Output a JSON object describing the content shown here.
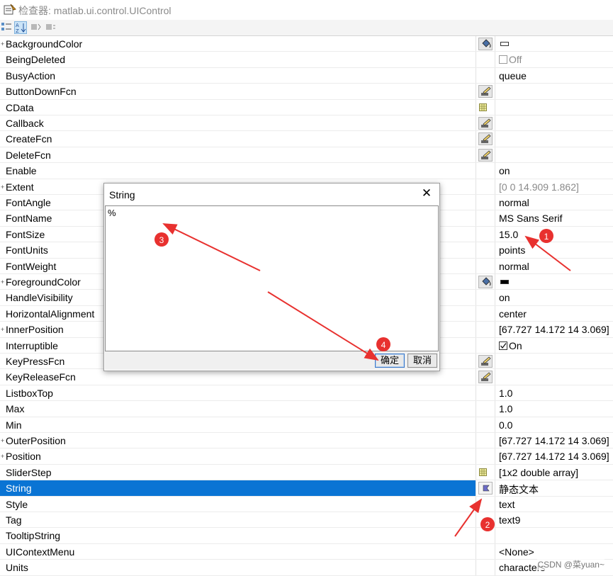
{
  "window": {
    "title": "检查器: matlab.ui.control.UIControl"
  },
  "toolbar": {
    "icons": [
      "categorized-icon",
      "alphabetical-icon",
      "expand-all-icon",
      "collapse-all-icon"
    ]
  },
  "properties": [
    {
      "name": "BackgroundColor",
      "value": "",
      "expandable": true,
      "button": "paint",
      "swatch": "#ffffff"
    },
    {
      "name": "BeingDeleted",
      "value": "Off",
      "checkbox": false,
      "disabled": true
    },
    {
      "name": "BusyAction",
      "value": "queue"
    },
    {
      "name": "ButtonDownFcn",
      "value": "",
      "button": "edit"
    },
    {
      "name": "CData",
      "value": "",
      "button": "array"
    },
    {
      "name": "Callback",
      "value": "",
      "button": "edit"
    },
    {
      "name": "CreateFcn",
      "value": "",
      "button": "edit"
    },
    {
      "name": "DeleteFcn",
      "value": "",
      "button": "edit"
    },
    {
      "name": "Enable",
      "value": "on"
    },
    {
      "name": "Extent",
      "value": "[0 0 14.909 1.862]",
      "expandable": true,
      "gray": true
    },
    {
      "name": "FontAngle",
      "value": "normal"
    },
    {
      "name": "FontName",
      "value": "MS Sans Serif"
    },
    {
      "name": "FontSize",
      "value": "15.0"
    },
    {
      "name": "FontUnits",
      "value": "points"
    },
    {
      "name": "FontWeight",
      "value": "normal"
    },
    {
      "name": "ForegroundColor",
      "value": "",
      "expandable": true,
      "button": "paint",
      "swatch": "#000000"
    },
    {
      "name": "HandleVisibility",
      "value": "on"
    },
    {
      "name": "HorizontalAlignment",
      "value": "center"
    },
    {
      "name": "InnerPosition",
      "value": "[67.727 14.172 14 3.069]",
      "expandable": true
    },
    {
      "name": "Interruptible",
      "value": "On",
      "checkbox": true
    },
    {
      "name": "KeyPressFcn",
      "value": "",
      "button": "edit"
    },
    {
      "name": "KeyReleaseFcn",
      "value": "",
      "button": "edit"
    },
    {
      "name": "ListboxTop",
      "value": "1.0"
    },
    {
      "name": "Max",
      "value": "1.0"
    },
    {
      "name": "Min",
      "value": "0.0"
    },
    {
      "name": "OuterPosition",
      "value": "[67.727 14.172 14 3.069]",
      "expandable": true
    },
    {
      "name": "Position",
      "value": "[67.727 14.172 14 3.069]",
      "expandable": true
    },
    {
      "name": "SliderStep",
      "value": "[1x2  double array]",
      "button": "array"
    },
    {
      "name": "String",
      "value": "静态文本",
      "button": "string",
      "selected": true
    },
    {
      "name": "Style",
      "value": "text"
    },
    {
      "name": "Tag",
      "value": "text9"
    },
    {
      "name": "TooltipString",
      "value": ""
    },
    {
      "name": "UIContextMenu",
      "value": "<None>"
    },
    {
      "name": "Units",
      "value": "characters"
    }
  ],
  "dialog": {
    "title": "String",
    "text_value": "%",
    "ok_label": "确定",
    "cancel_label": "取消"
  },
  "annotations": {
    "markers": [
      "1",
      "2",
      "3",
      "4"
    ],
    "color": "#e8312f"
  },
  "watermark": "CSDN @菜yuan~"
}
